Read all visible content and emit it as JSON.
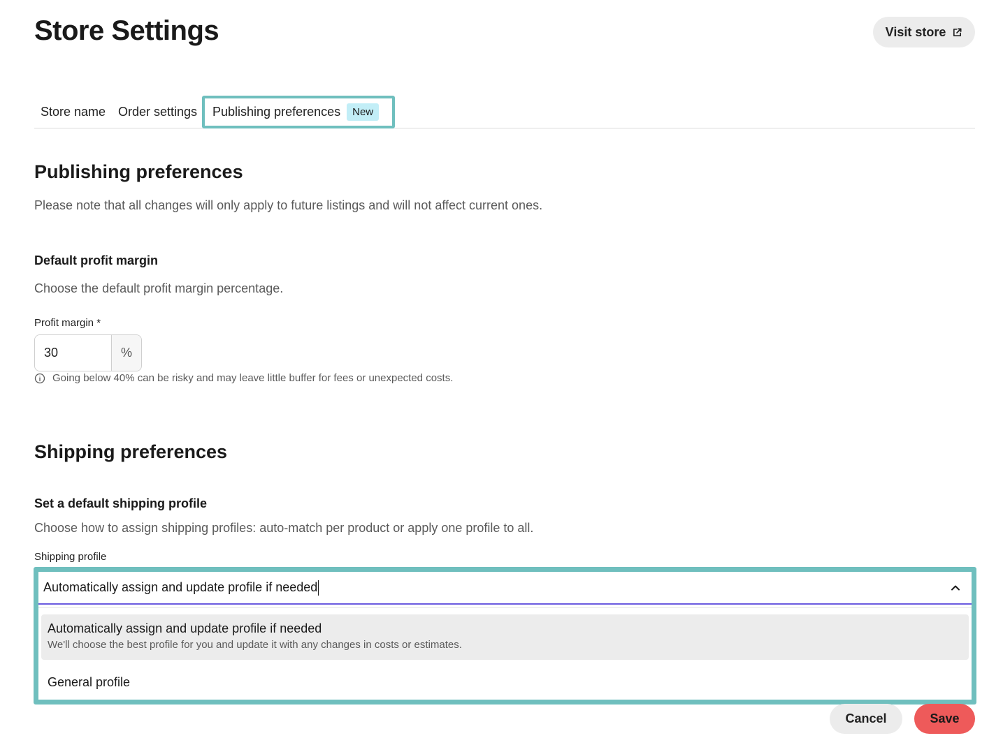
{
  "header": {
    "title": "Store Settings",
    "visit_store_label": "Visit store",
    "visit_store_icon": "external-link-icon"
  },
  "tabs": [
    {
      "label": "Store name",
      "active": false
    },
    {
      "label": "Order settings",
      "active": false
    },
    {
      "label": "Publishing preferences",
      "active": true,
      "badge": "New"
    }
  ],
  "publishing": {
    "title": "Publishing preferences",
    "note": "Please note that all changes will only apply to future listings and will not affect current ones.",
    "profit": {
      "title": "Default profit margin",
      "description": "Choose the default profit margin percentage.",
      "label": "Profit margin *",
      "value": "30",
      "suffix": "%",
      "hint_icon": "info-icon",
      "hint": "Going below 40% can be risky and may leave little buffer for fees or unexpected costs."
    }
  },
  "shipping": {
    "title": "Shipping preferences",
    "subtitle": "Set a default shipping profile",
    "description": "Choose how to assign shipping profiles: auto-match per product or apply one profile to all.",
    "field_label": "Shipping profile",
    "selected_value": "Automatically assign and update profile if needed",
    "chevron_icon": "chevron-up-icon",
    "options": [
      {
        "title": "Automatically assign and update profile if needed",
        "description": "We'll choose the best profile for you and update it with any changes in costs or estimates.",
        "highlighted": true
      },
      {
        "title": "General profile",
        "description": "",
        "highlighted": false
      }
    ]
  },
  "footer": {
    "cancel_label": "Cancel",
    "save_label": "Save"
  },
  "colors": {
    "accent_frame": "#6fbfbe",
    "focus_underline": "#6b5be0",
    "save_button": "#ee5a5a",
    "badge_bg": "#c2eef7"
  }
}
